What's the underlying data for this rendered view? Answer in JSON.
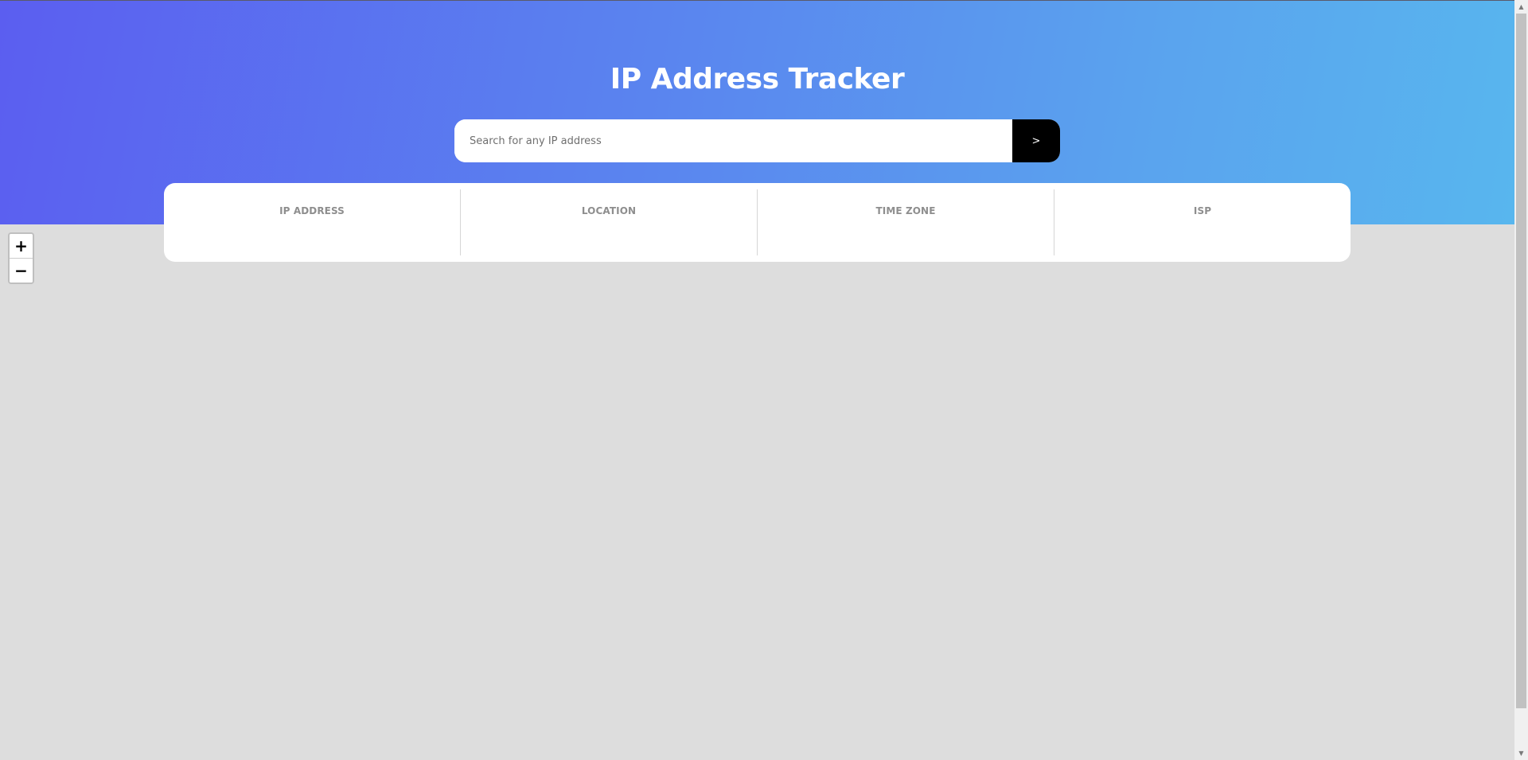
{
  "header": {
    "title": "IP Address Tracker",
    "gradient_colors": [
      "#5b5ef0",
      "#5a86ef",
      "#5aa3ee",
      "#58b6ee"
    ]
  },
  "search": {
    "placeholder": "Search for any IP address",
    "value": "",
    "button_label": ">"
  },
  "info": {
    "ip_label": "IP ADDRESS",
    "ip_value": "",
    "location_label": "LOCATION",
    "location_value": "",
    "timezone_label": "TIME ZONE",
    "timezone_value": "",
    "isp_label": "ISP",
    "isp_value": ""
  },
  "map": {
    "zoom_in_label": "+",
    "zoom_out_label": "−",
    "background": "#dddddd"
  },
  "scrollbar": {
    "up_arrow": "▲",
    "down_arrow": "▼"
  }
}
